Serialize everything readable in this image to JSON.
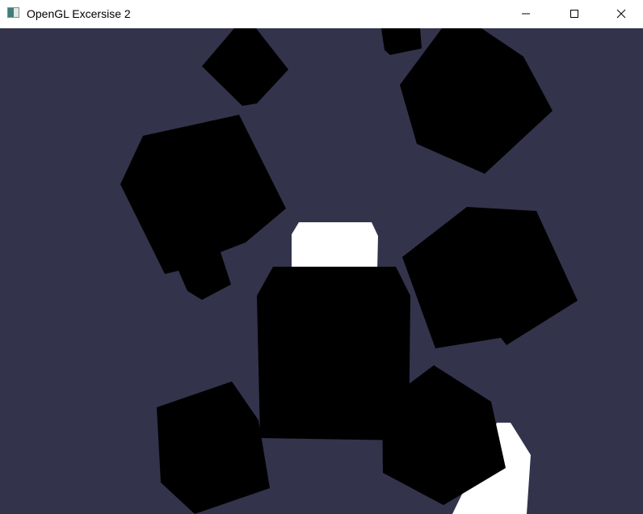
{
  "window": {
    "title": "OpenGL Excersise 2",
    "icon": "app-window-icon",
    "controls": {
      "minimize": "minimize-icon",
      "maximize": "maximize-icon",
      "close": "close-icon"
    }
  },
  "scene": {
    "clear_color": "#33334c",
    "cube_color": "#000000",
    "lit_cube_color": "#ffffff"
  }
}
